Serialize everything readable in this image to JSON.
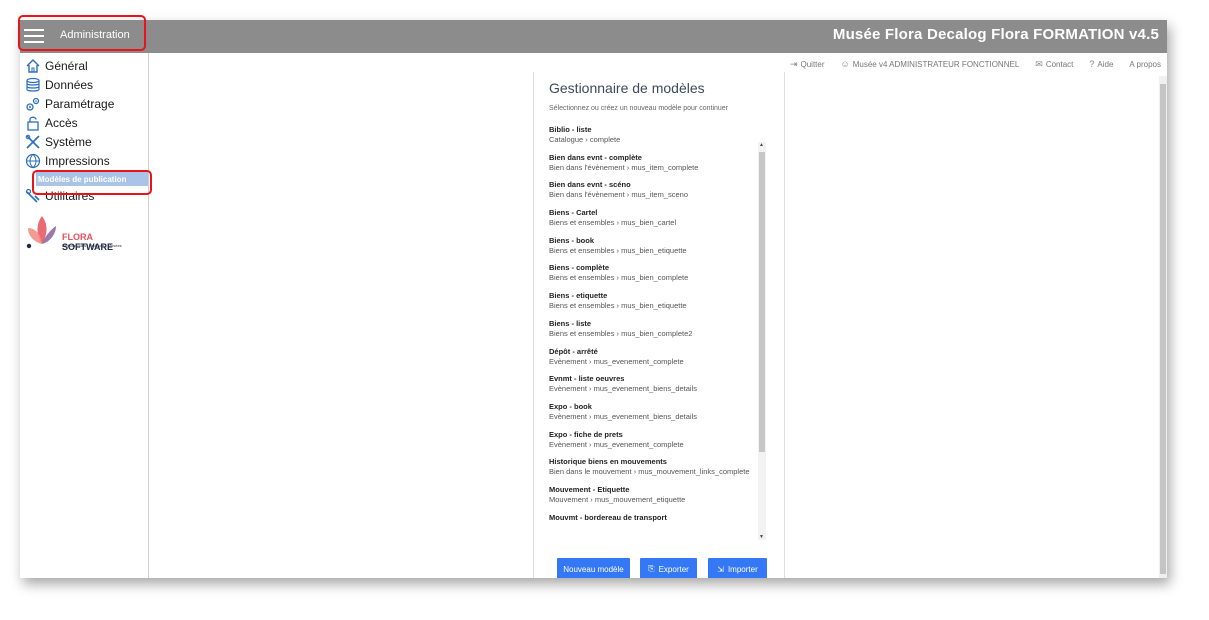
{
  "header": {
    "menu_label": "Administration",
    "app_title": "Musée Flora Decalog Flora FORMATION v4.5"
  },
  "sidebar": {
    "items": [
      {
        "label": "Général",
        "icon": "home-icon"
      },
      {
        "label": "Données",
        "icon": "database-icon"
      },
      {
        "label": "Paramétrage",
        "icon": "gears-icon"
      },
      {
        "label": "Accès",
        "icon": "lock-icon"
      },
      {
        "label": "Système",
        "icon": "tools-icon"
      },
      {
        "label": "Impressions",
        "icon": "globe-icon"
      },
      {
        "label": "Utilitaires",
        "icon": "wrench-icon"
      }
    ],
    "sub_item": "Modèles de publication",
    "logo": {
      "name_part1": "FLORA",
      "name_part2": "SOFTWARE",
      "tagline": "Bibliothèques | Archives | Musées"
    }
  },
  "toplinks": {
    "quit": "Quitter",
    "user": "Musée v4 ADMINISTRATEUR FONCTIONNEL",
    "contact": "Contact",
    "help": "Aide",
    "about": "A propos"
  },
  "panel": {
    "title": "Gestionnaire de modèles",
    "subtitle": "Sélectionnez ou créez un nouveau modèle pour continuer",
    "items": [
      {
        "name": "Biblio - liste",
        "path": "Catalogue › complete"
      },
      {
        "name": "Bien dans evnt - complète",
        "path": "Bien dans l'évènement › mus_item_complete"
      },
      {
        "name": "Bien dans evnt - scéno",
        "path": "Bien dans l'évènement › mus_item_sceno"
      },
      {
        "name": "Biens - Cartel",
        "path": "Biens et ensembles › mus_bien_cartel"
      },
      {
        "name": "Biens - book",
        "path": "Biens et ensembles › mus_bien_etiquette"
      },
      {
        "name": "Biens - complète",
        "path": "Biens et ensembles › mus_bien_complete"
      },
      {
        "name": "Biens - etiquette",
        "path": "Biens et ensembles › mus_bien_etiquette"
      },
      {
        "name": "Biens - liste",
        "path": "Biens et ensembles › mus_bien_complete2"
      },
      {
        "name": "Dépôt - arrêté",
        "path": "Evènement › mus_evenement_complete"
      },
      {
        "name": "Evnmt - liste oeuvres",
        "path": "Evènement › mus_evenement_biens_details"
      },
      {
        "name": "Expo - book",
        "path": "Evènement › mus_evenement_biens_details"
      },
      {
        "name": "Expo - fiche de prets",
        "path": "Evènement › mus_evenement_complete"
      },
      {
        "name": "Historique biens en mouvements",
        "path": "Bien dans le mouvement › mus_mouvement_links_complete"
      },
      {
        "name": "Mouvement - Etiquette",
        "path": "Mouvement › mus_mouvement_etiquette"
      },
      {
        "name": "Mouvmt - bordereau de transport",
        "path": ""
      }
    ],
    "buttons": {
      "new": "Nouveau modèle",
      "export": "Exporter",
      "import": "Importer"
    }
  },
  "colors": {
    "topbar": "#8c8c8c",
    "highlight": "#e8141a",
    "primary": "#3478f6",
    "icon": "#2a6fbd"
  }
}
